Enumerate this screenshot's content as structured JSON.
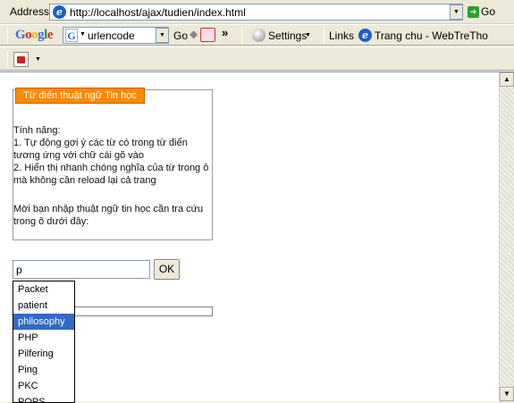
{
  "address_bar": {
    "label": "Address",
    "url": "http://localhost/ajax/tudien/index.html",
    "go_label": "Go"
  },
  "google_toolbar": {
    "logo": "Google",
    "search_value": "urlencode",
    "go_label": "Go",
    "chevron": "»",
    "settings_label": "Settings",
    "links_label": "Links",
    "link_item": "Trang chu - WebTreTho"
  },
  "page": {
    "legend": "Từ điển thuật ngữ Tin học",
    "info_lines": [
      "Tính năng:",
      " 1. Tự động gợi ý các từ có trong từ điển",
      "tương ứng với chữ cái gõ vào",
      " 2. Hiển thị nhanh chóng nghĩa của từ trong ô",
      "mà không cần reload lại cả trang",
      "",
      "Mời bạn nhập thuật ngữ tin học cần tra cứu",
      "trong ô dưới đây:"
    ],
    "search_value": "p",
    "ok_label": "OK",
    "suggestions": [
      "Packet",
      "patient",
      "philosophy",
      "PHP",
      "Pilfering",
      "Ping",
      "PKC",
      "POPS"
    ],
    "selected_suggestion": "philosophy"
  },
  "icons": {
    "up_arrow": "▲",
    "down_arrow": "▼",
    "dropdown_arrow": "▼"
  },
  "colors": {
    "legend_bg": "#ff8a00",
    "selection_bg": "#316ac5"
  }
}
